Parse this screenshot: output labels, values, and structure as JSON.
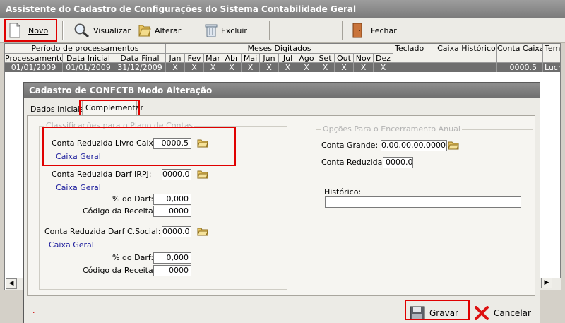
{
  "window": {
    "title": "Assistente do Cadastro de Configurações do Sistema Contabilidade Geral"
  },
  "toolbar": {
    "novo": "Novo",
    "visualizar": "Visualizar",
    "alterar": "Alterar",
    "excluir": "Excluir",
    "fechar": "Fechar"
  },
  "grid": {
    "group_periodo": "Período de processamentos",
    "group_meses": "Meses Digitados",
    "col_processamento": "Processamento",
    "col_data_inicial": "Data Inicial",
    "col_data_final": "Data Final",
    "months": [
      "Jan",
      "Fev",
      "Mar",
      "Abr",
      "Mai",
      "Jun",
      "Jul",
      "Ago",
      "Set",
      "Out",
      "Nov",
      "Dez"
    ],
    "col_teclado": "Teclado",
    "col_caixa": "Caixa",
    "col_historico": "Histórico",
    "col_conta_caixa": "Conta Caixa",
    "col_tem": "Tem",
    "row": {
      "processamento": "01/01/2009",
      "data_inicial": "01/01/2009",
      "data_final": "31/12/2009",
      "marks": [
        "X",
        "X",
        "X",
        "X",
        "X",
        "X",
        "X",
        "X",
        "X",
        "X",
        "X",
        "X"
      ],
      "conta_caixa": "0000.5",
      "tem": "Lucr"
    }
  },
  "dialog": {
    "title": "Cadastro de CONFCTB Modo Alteração",
    "tabs": [
      "Dados Iniciais",
      "Complementar"
    ],
    "left_group_legend": "Classificações para o Plano de Contas",
    "right_group_legend": "Opções Para o Encerramento Anual",
    "conta_livro_caixa_label": "Conta Reduzida Livro Caixa:",
    "conta_livro_caixa_value": "0000.5",
    "conta_livro_caixa_desc": "Caixa Geral",
    "darf_irpj_label": "Conta Reduzida Darf IRPJ:",
    "darf_irpj_value": "0000.0",
    "darf_irpj_desc": "Caixa Geral",
    "pct_darf_label": "% do Darf:",
    "pct_darf_value": "0,000",
    "codigo_receita_label": "Código da Receita:",
    "codigo_receita_value": "0000",
    "darf_csocial_label": "Conta Reduzida Darf C.Social:",
    "darf_csocial_value": "0000.0",
    "darf_csocial_desc": "Caixa Geral",
    "pct_darf2_value": "0,000",
    "codigo_receita2_value": "0000",
    "conta_grande_label": "Conta Grande:",
    "conta_grande_value": "0.00.00.00.0000",
    "conta_reduzida_label": "Conta Reduzida:",
    "conta_reduzida_value": "0000.0",
    "historico_label": "Histórico:",
    "historico_value": "",
    "gravar": "Gravar",
    "cancelar": "Cancelar",
    "status_mark": "."
  },
  "colors": {
    "highlight": "#e00000",
    "link": "#1a1a9c",
    "selected_row": "#6e6e6e"
  }
}
